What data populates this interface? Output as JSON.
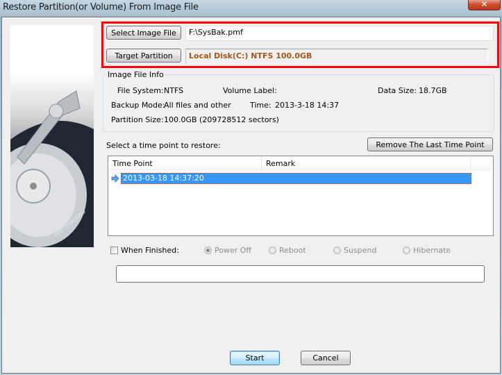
{
  "window": {
    "title": "Restore Partition(or Volume) From Image File",
    "close_glyph": "✕"
  },
  "side_image": {
    "brand_text": "PARTITIONGURU"
  },
  "source": {
    "select_image_label": "Select Image File",
    "image_file_value": "F:\\SysBak.pmf",
    "target_partition_label": "Target Partition",
    "target_partition_value": "Local Disk(C:) NTFS 100.0GB",
    "highlight_color": "#ff0000",
    "target_text_color": "#a4571a"
  },
  "image_info": {
    "title": "Image File Info",
    "file_system_label": "File System:",
    "file_system_value": "NTFS",
    "volume_label_label": "Volume Label:",
    "volume_label_value": "",
    "data_size_label": "Data Size:",
    "data_size_value": "18.7GB",
    "backup_mode_label": "Backup Mode:",
    "backup_mode_value": "All files and other",
    "time_label": "Time:",
    "time_value": "2013-3-18 14:37",
    "partition_size_label": "Partition Size:",
    "partition_size_value": "100.0GB  (209728512 sectors)"
  },
  "time_points": {
    "prompt": "Select a time point to restore:",
    "remove_button": "Remove The Last Time Point",
    "columns": [
      "Time Point",
      "Remark"
    ],
    "rows": [
      {
        "time_point": "2013-03-18 14:37:20",
        "remark": "",
        "selected": true
      }
    ],
    "selection_color": "#3399ff"
  },
  "when_finished": {
    "label": "When Finished:",
    "checked": false,
    "options": [
      {
        "label": "Power Off",
        "selected": true
      },
      {
        "label": "Reboot",
        "selected": false
      },
      {
        "label": "Suspend",
        "selected": false
      },
      {
        "label": "Hibernate",
        "selected": false
      }
    ]
  },
  "progress": {
    "value": 0
  },
  "footer": {
    "start_label": "Start",
    "cancel_label": "Cancel"
  }
}
